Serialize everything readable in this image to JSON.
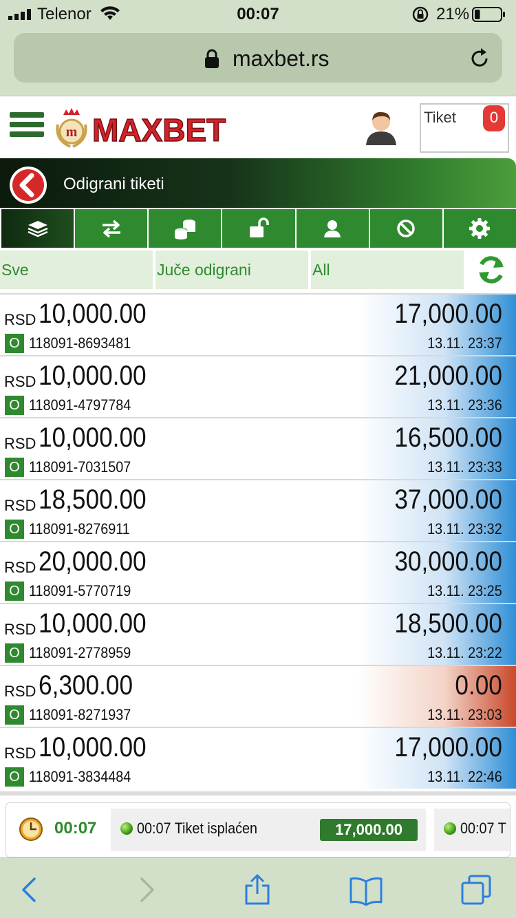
{
  "status_bar": {
    "carrier": "Telenor",
    "time": "00:07",
    "battery_percent": "21%",
    "battery_level": 0.21
  },
  "browser": {
    "url": "maxbet.rs"
  },
  "header": {
    "logo_text": "MAXBET",
    "tiket_label": "Tiket",
    "tiket_count": "0"
  },
  "page": {
    "title": "Odigrani tiketi"
  },
  "tabs": [
    {
      "icon": "stack-icon",
      "active": true
    },
    {
      "icon": "transfer-arrows-icon",
      "active": false
    },
    {
      "icon": "coins-icon",
      "active": false
    },
    {
      "icon": "unlock-icon",
      "active": false
    },
    {
      "icon": "user-icon",
      "active": false
    },
    {
      "icon": "ban-icon",
      "active": false
    },
    {
      "icon": "gear-icon",
      "active": false
    }
  ],
  "filters": {
    "type": "Sve",
    "period": "Juče odigrani",
    "category": "All"
  },
  "tickets": [
    {
      "currency": "RSD",
      "stake": "10,000.00",
      "status": "O",
      "id": "118091-8693481",
      "win": "17,000.00",
      "date": "13.11. 23:37",
      "result": "won"
    },
    {
      "currency": "RSD",
      "stake": "10,000.00",
      "status": "O",
      "id": "118091-4797784",
      "win": "21,000.00",
      "date": "13.11. 23:36",
      "result": "won"
    },
    {
      "currency": "RSD",
      "stake": "10,000.00",
      "status": "O",
      "id": "118091-7031507",
      "win": "16,500.00",
      "date": "13.11. 23:33",
      "result": "won"
    },
    {
      "currency": "RSD",
      "stake": "18,500.00",
      "status": "O",
      "id": "118091-8276911",
      "win": "37,000.00",
      "date": "13.11. 23:32",
      "result": "won"
    },
    {
      "currency": "RSD",
      "stake": "20,000.00",
      "status": "O",
      "id": "118091-5770719",
      "win": "30,000.00",
      "date": "13.11. 23:25",
      "result": "won"
    },
    {
      "currency": "RSD",
      "stake": "10,000.00",
      "status": "O",
      "id": "118091-2778959",
      "win": "18,500.00",
      "date": "13.11. 23:22",
      "result": "won"
    },
    {
      "currency": "RSD",
      "stake": "6,300.00",
      "status": "O",
      "id": "118091-8271937",
      "win": "0.00",
      "date": "13.11. 23:03",
      "result": "lost"
    },
    {
      "currency": "RSD",
      "stake": "10,000.00",
      "status": "O",
      "id": "118091-3834484",
      "win": "17,000.00",
      "date": "13.11. 22:46",
      "result": "won"
    }
  ],
  "ticker": {
    "time": "00:07",
    "items": [
      {
        "text": "00:07 Tiket isplaćen",
        "amount": "17,000.00"
      },
      {
        "text": "00:07 T",
        "amount": ""
      }
    ]
  },
  "colors": {
    "brand_green": "#2f8a2f",
    "won_blue": "#2f8fd6",
    "lost_red": "#c9482a",
    "badge_red": "#e53935",
    "browser_chrome": "#d2e0c9"
  }
}
